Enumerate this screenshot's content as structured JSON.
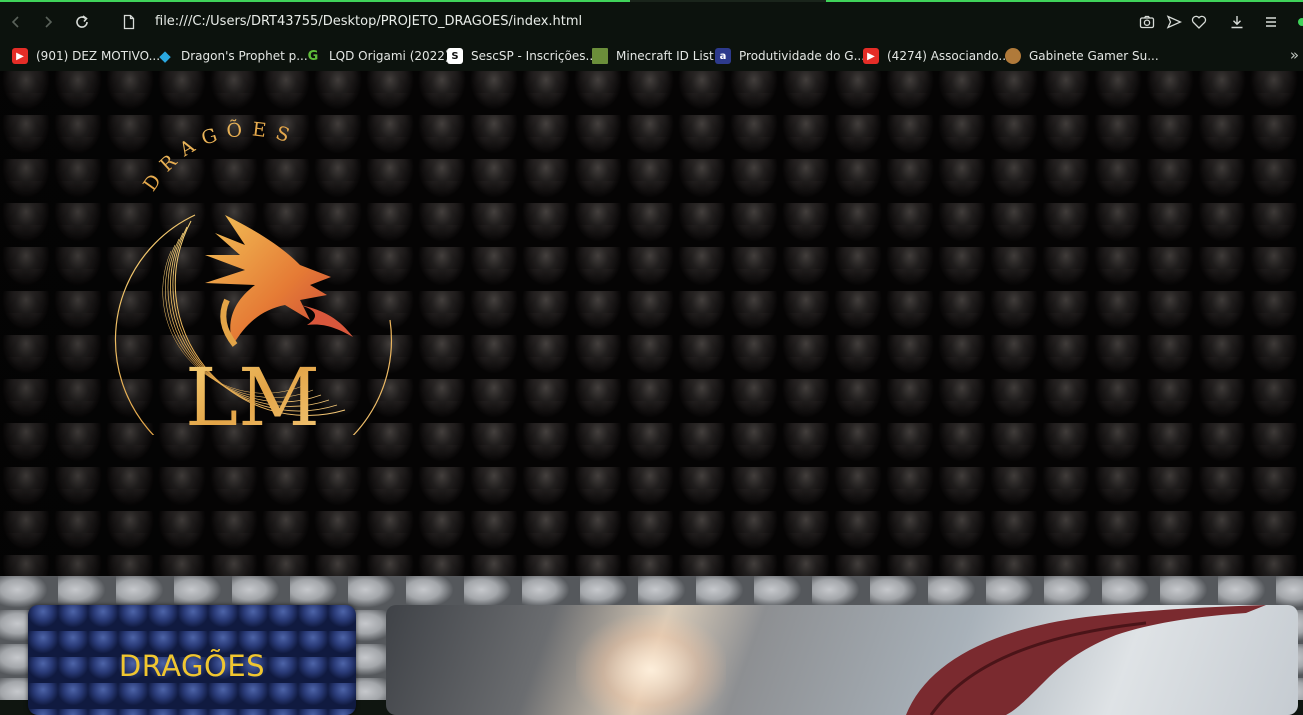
{
  "browser": {
    "url": "file:///C:/Users/DRT43755/Desktop/PROJETO_DRAGOES/index.html",
    "accent_color": "#3fd35a",
    "nav_icons": [
      "back-icon",
      "forward-icon",
      "reload-icon",
      "page-icon"
    ],
    "toolbar_icons": [
      "camera-icon",
      "send-icon",
      "heart-icon",
      "download-icon",
      "menu-icon"
    ]
  },
  "bookmarks": [
    {
      "label": "(901) DEZ MOTIVO...",
      "icon": "youtube-icon",
      "color": "#e52d27"
    },
    {
      "label": "Dragon's Prophet p...",
      "icon": "diamond-icon",
      "color": "#2aa8e0"
    },
    {
      "label": "LQD Origami (2022)",
      "icon": "g-icon",
      "color": "#5fbf3a"
    },
    {
      "label": "SescSP - Inscrições...",
      "icon": "s-icon",
      "color": "#ffffff"
    },
    {
      "label": "Minecraft ID List",
      "icon": "block-icon",
      "color": "#6b8e3a"
    },
    {
      "label": "Produtividade do G...",
      "icon": "a-icon",
      "color": "#2d3a8c"
    },
    {
      "label": "(4274) Associando...",
      "icon": "youtube-icon",
      "color": "#e52d27"
    },
    {
      "label": "Gabinete Gamer Su...",
      "icon": "store-icon",
      "color": "#b07a3a"
    }
  ],
  "logo": {
    "arc_text": "DRAGÕES",
    "monogram": "LM",
    "gold": "#e8b24a"
  },
  "sidebar": {
    "title": "DRAGÕES",
    "title_color": "#f0c630"
  }
}
